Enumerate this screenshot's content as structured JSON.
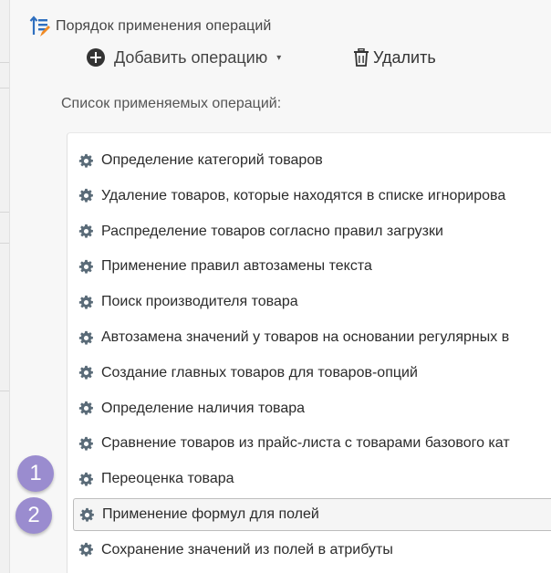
{
  "window": {
    "title": "Порядок применения операций",
    "title_icon": "sort-order-icon"
  },
  "toolbar": {
    "add_label": "Добавить операцию",
    "add_icon": "plus-circle-icon",
    "add_caret": "▾",
    "delete_label": "Удалить",
    "delete_icon": "trash-icon"
  },
  "list": {
    "label": "Список применяемых операций:",
    "item_icon": "gear-icon",
    "items": [
      {
        "label": "Определение категорий товаров"
      },
      {
        "label": "Удаление товаров, которые находятся в списке игнорирова"
      },
      {
        "label": "Распределение товаров согласно правил загрузки"
      },
      {
        "label": "Применение правил автозамены текста"
      },
      {
        "label": "Поиск производителя товара"
      },
      {
        "label": "Автозамена значений у товаров на основании регулярных в"
      },
      {
        "label": "Создание главных товаров для товаров-опций"
      },
      {
        "label": "Определение наличия товара"
      },
      {
        "label": "Сравнение товаров из прайс-листа с товарами базового кат"
      },
      {
        "label": "Переоценка товара"
      },
      {
        "label": "Применение формул для полей",
        "selected": true
      },
      {
        "label": "Сохранение значений из полей в атрибуты"
      }
    ]
  },
  "annotations": {
    "badge_1": "1",
    "badge_2": "2",
    "badge_color": "#9a8ccf"
  },
  "colors": {
    "accent_icon_blue": "#2f6fbf",
    "accent_icon_orange": "#f08a24",
    "gear": "#5a6b78"
  }
}
